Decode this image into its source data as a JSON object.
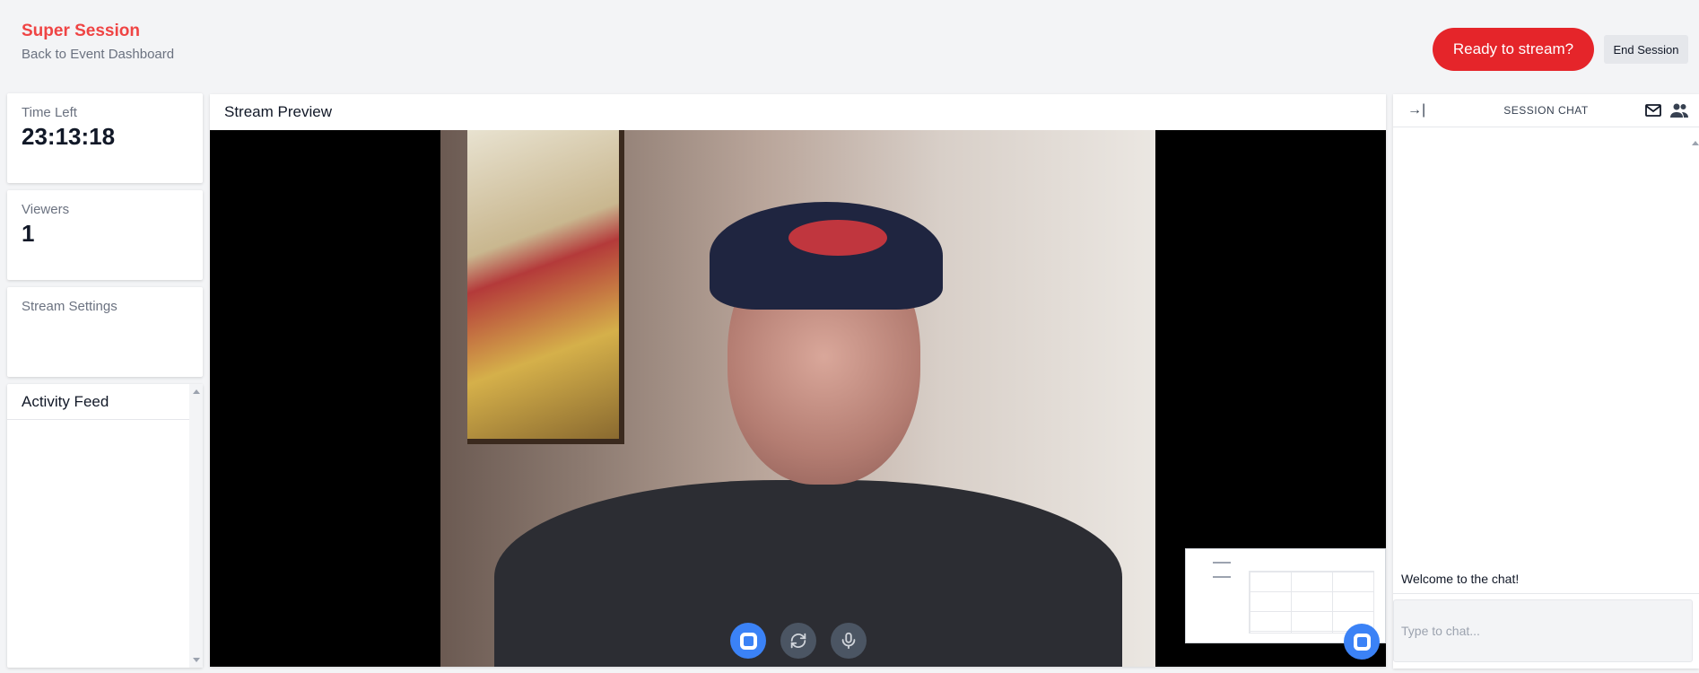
{
  "header": {
    "title": "Super Session",
    "back_link": "Back to Event Dashboard",
    "ready_button": "Ready to stream?",
    "end_button": "End Session"
  },
  "stats": {
    "time_left_label": "Time Left",
    "time_left_value": "23:13:18",
    "viewers_label": "Viewers",
    "viewers_value": "1",
    "settings_label": "Stream Settings"
  },
  "activity_feed": {
    "title": "Activity Feed"
  },
  "stream": {
    "title": "Stream Preview",
    "controls": [
      "stop-icon",
      "rotate-camera-icon",
      "microphone-icon"
    ]
  },
  "chat": {
    "title": "SESSION CHAT",
    "messages": [
      "Welcome to the chat!"
    ],
    "input_placeholder": "Type to chat..."
  },
  "colors": {
    "brand_red": "#ef4444",
    "ready_button": "#e5252a",
    "control_blue": "#3b82f6",
    "control_gray": "#4b5563"
  }
}
